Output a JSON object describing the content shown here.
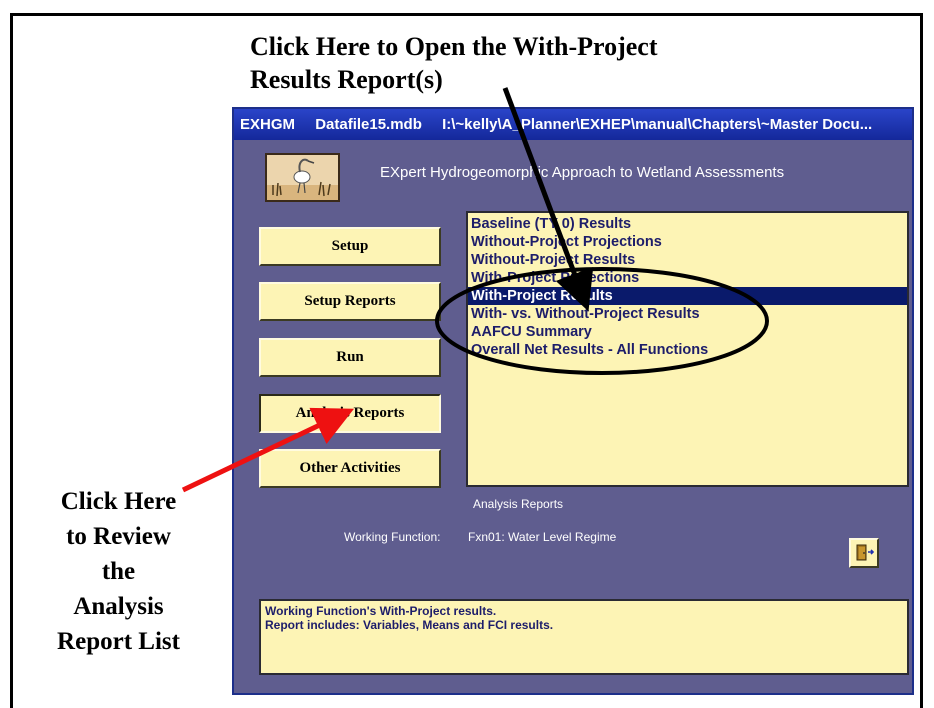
{
  "callouts": {
    "top_line1": "Click Here to Open the With-Project",
    "top_line2": "Results Report(s)",
    "left_lines": [
      "Click Here",
      "to Review",
      "the",
      "Analysis",
      "Report List"
    ]
  },
  "window": {
    "title_parts": [
      "EXHGM",
      "Datafile15.mdb",
      "I:\\~kelly\\A_Planner\\EXHEP\\manual\\Chapters\\~Master Docu..."
    ],
    "heading": "EXpert Hydrogeomorphic Approach to Wetland Assessments"
  },
  "buttons": {
    "setup": "Setup",
    "setup_reports": "Setup Reports",
    "run": "Run",
    "analysis_reports": "Analysis Reports",
    "other_activities": "Other Activities"
  },
  "report_list": {
    "items": [
      "Baseline (TY 0) Results",
      "Without-Project Projections",
      "Without-Project Results",
      "With-Project Projections",
      "With-Project Results",
      "With- vs. Without-Project Results",
      "AAFCU Summary",
      "Overall Net Results - All Functions"
    ],
    "selected_index": 4,
    "caption": "Analysis Reports"
  },
  "working_function": {
    "label": "Working Function:",
    "value": "Fxn01: Water Level Regime"
  },
  "description": {
    "line1": "Working Function's With-Project results.",
    "line2": "Report includes:  Variables, Means and FCI results."
  },
  "colors": {
    "window_bg": "#5f5d8f",
    "title_bar": "#1f37b8",
    "button_face": "#fdf4b5",
    "selection": "#0a1a6b",
    "annotation_red": "#ee1111"
  },
  "icons": {
    "exit": "door-exit-icon",
    "logo": "heron-logo"
  }
}
